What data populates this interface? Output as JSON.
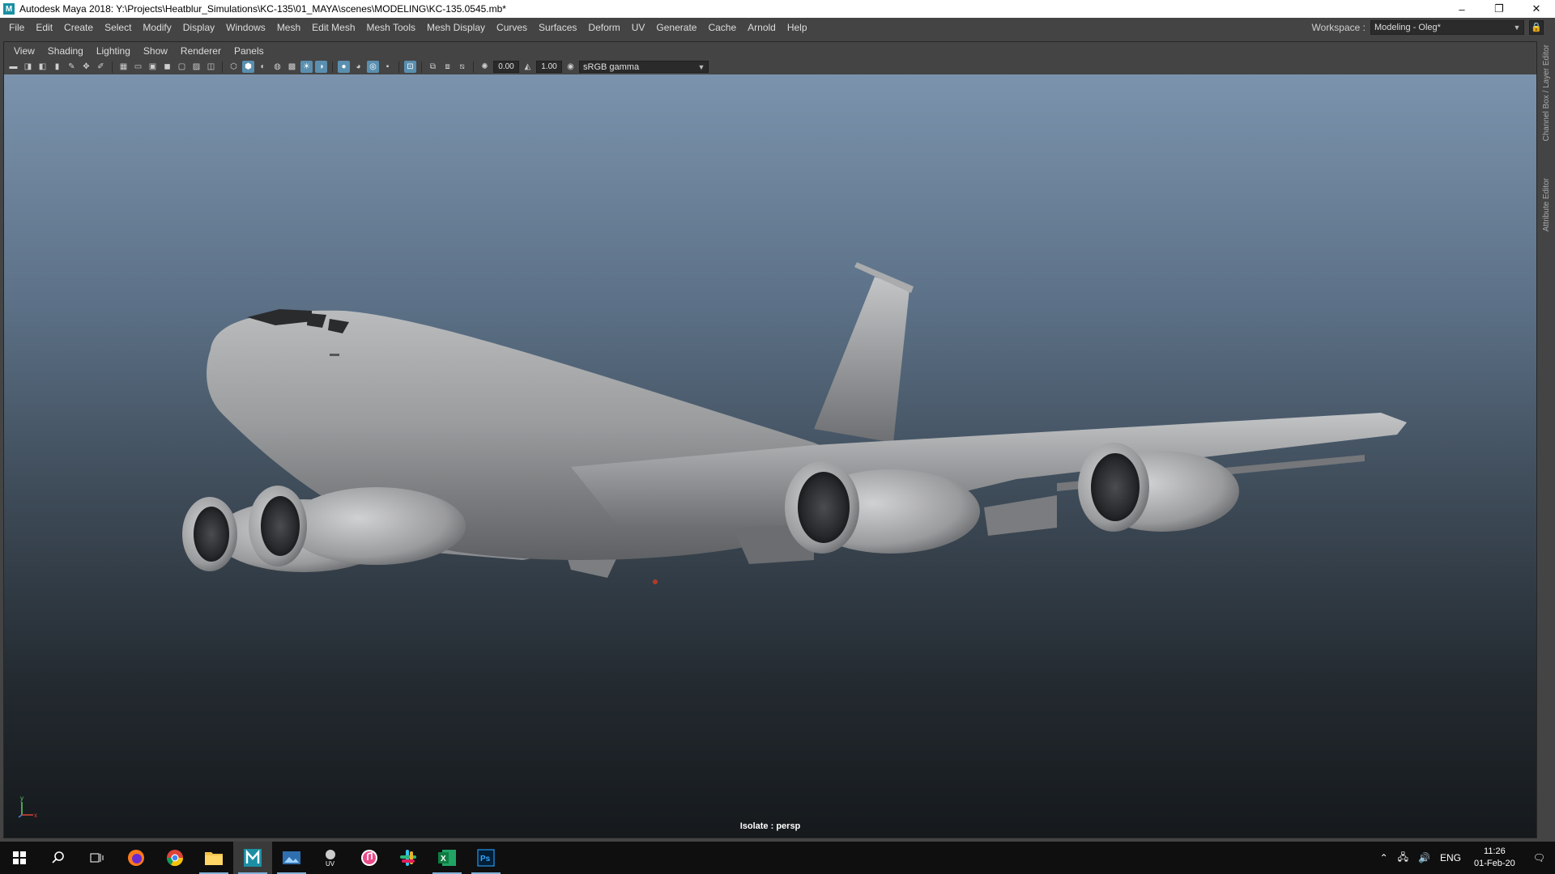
{
  "window": {
    "title": "Autodesk Maya 2018: Y:\\Projects\\Heatblur_Simulations\\KC-135\\01_MAYA\\scenes\\MODELING\\KC-135.0545.mb*",
    "minimize_glyph": "–",
    "restore_glyph": "❐",
    "close_glyph": "✕"
  },
  "main_menu": [
    "File",
    "Edit",
    "Create",
    "Select",
    "Modify",
    "Display",
    "Windows",
    "Mesh",
    "Edit Mesh",
    "Mesh Tools",
    "Mesh Display",
    "Curves",
    "Surfaces",
    "Deform",
    "UV",
    "Generate",
    "Cache",
    "Arnold",
    "Help"
  ],
  "workspace": {
    "label": "Workspace :",
    "value": "Modeling - Oleg*"
  },
  "panel_menu": [
    "View",
    "Shading",
    "Lighting",
    "Show",
    "Renderer",
    "Panels"
  ],
  "panel_toolbar": {
    "exposure": "0.00",
    "gamma": "1.00",
    "color_space": "sRGB gamma"
  },
  "viewport": {
    "status_text": "Isolate : persp",
    "axis_y": "y",
    "axis_x": "x",
    "background_top": "#7b93ad",
    "background_bottom": "#15191c"
  },
  "side_tabs": [
    "Channel Box / Layer Editor",
    "Attribute Editor"
  ],
  "taskbar": {
    "apps": [
      "windows-start-icon",
      "search-icon",
      "task-view-icon",
      "firefox-icon",
      "chrome-icon",
      "file-explorer-icon",
      "maya-icon",
      "photo-viewer-icon",
      "uv-tool-icon",
      "itunes-icon",
      "slack-icon",
      "excel-icon",
      "photoshop-icon"
    ],
    "tray_language": "ENG",
    "time": "11:26",
    "date": "01-Feb-20"
  }
}
